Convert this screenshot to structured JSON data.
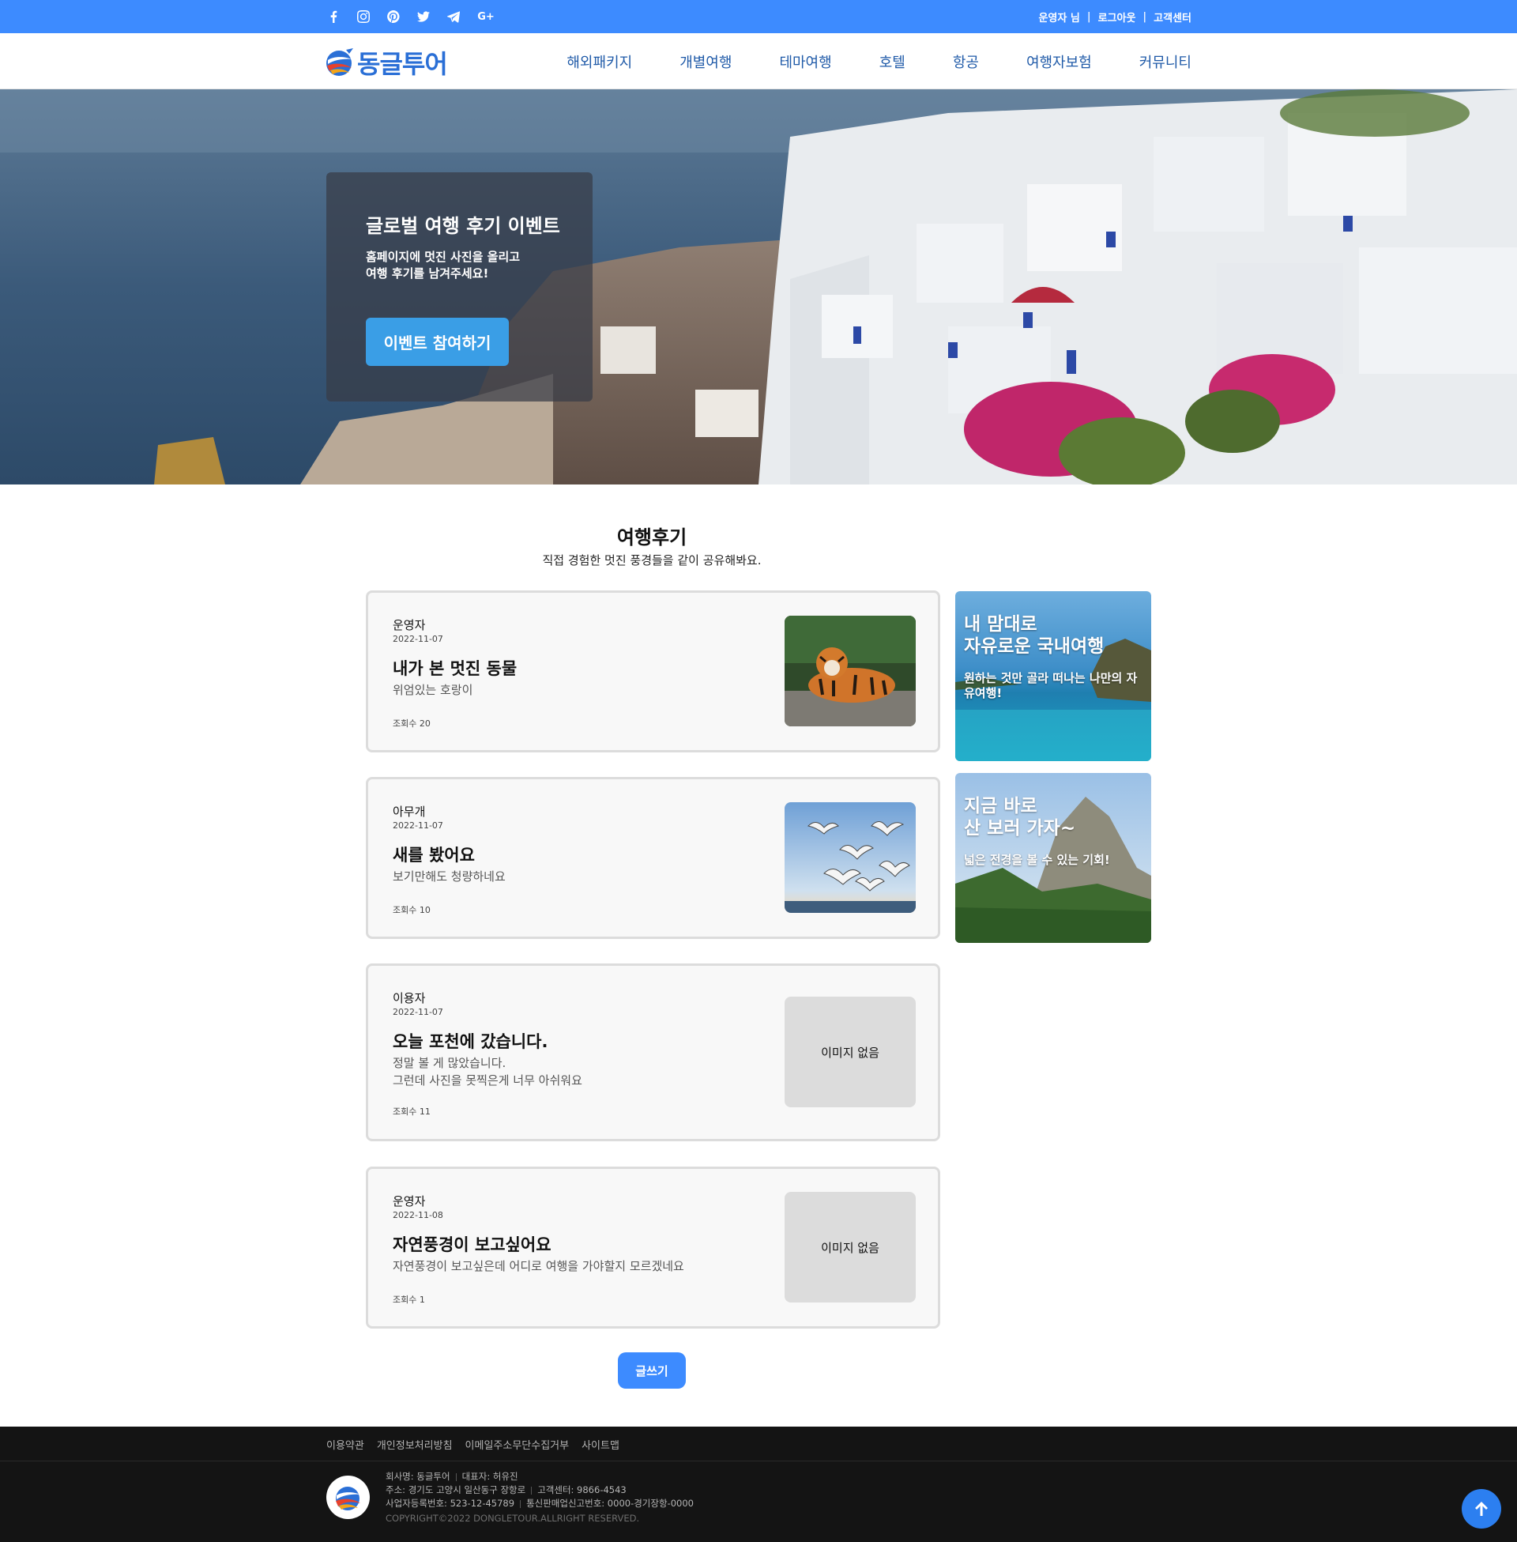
{
  "topbar": {
    "social": [
      "facebook-icon",
      "instagram-icon",
      "pinterest-icon",
      "twitter-icon",
      "telegram-icon",
      "google-plus-icon"
    ],
    "user_name": "운영자 님",
    "logout": "로그아웃",
    "support": "고객센터",
    "divider": "|"
  },
  "header": {
    "logo_text": "동글투어",
    "nav": [
      "해외패키지",
      "개별여행",
      "테마여행",
      "호텔",
      "항공",
      "여행자보험",
      "커뮤니티"
    ]
  },
  "hero": {
    "title": "글로벌 여행 후기 이벤트",
    "text_line1": "홈페이지에 멋진 사진을 올리고",
    "text_line2": "여행 후기를 남겨주세요!",
    "button": "이벤트 참여하기"
  },
  "reviews": {
    "title": "여행후기",
    "subtitle": "직접 경험한 멋진 풍경들을 같이 공유해봐요.",
    "items": [
      {
        "author": "운영자",
        "date": "2022-11-07",
        "title": "내가 본 멋진 동물",
        "desc": "위엄있는 호랑이",
        "views": "조회수 20"
      },
      {
        "author": "아무개",
        "date": "2022-11-07",
        "title": "새를 봤어요",
        "desc": "보기만해도 청량하네요",
        "views": "조회수 10"
      },
      {
        "author": "이용자",
        "date": "2022-11-07",
        "title": "오늘 포천에 갔습니다.",
        "desc": "정말 볼 게 많았습니다.\n그런데 사진을 못찍은게 너무 아쉬워요",
        "views": "조회수 11",
        "no_image": "이미지 없음"
      },
      {
        "author": "운영자",
        "date": "2022-11-08",
        "title": "자연풍경이 보고싶어요",
        "desc": "자연풍경이 보고싶은데 어디로 여행을 가야할지 모르겠네요",
        "views": "조회수 1",
        "no_image": "이미지 없음"
      }
    ],
    "write_button": "글쓰기"
  },
  "banners": [
    {
      "title": "내 맘대로\n자유로운 국내여행",
      "desc": "원하는 것만 골라 떠나는 나만의 자유여행!"
    },
    {
      "title": "지금 바로\n산 보러 가자~",
      "desc": "넓은 전경을 볼 수 있는 기회!"
    }
  ],
  "footer": {
    "links": [
      "이용약관",
      "개인정보처리방침",
      "이메일주소무단수집거부",
      "사이트맵"
    ],
    "company": "회사명: 동글투어",
    "ceo": "대표자: 허유진",
    "address": "주소: 경기도 고양시 일산동구 장항로",
    "cs": "고객센터: 9866-4543",
    "bizno": "사업자등록번호: 523-12-45789",
    "mailorder": "통신판매업신고번호: 0000-경기장항-0000",
    "copyright": "COPYRIGHT©2022 DONGLETOUR.ALLRIGHT RESERVED."
  },
  "colors": {
    "primary": "#3d8bff",
    "hero_button": "#3a9ee6",
    "footer_bg": "#141414"
  }
}
